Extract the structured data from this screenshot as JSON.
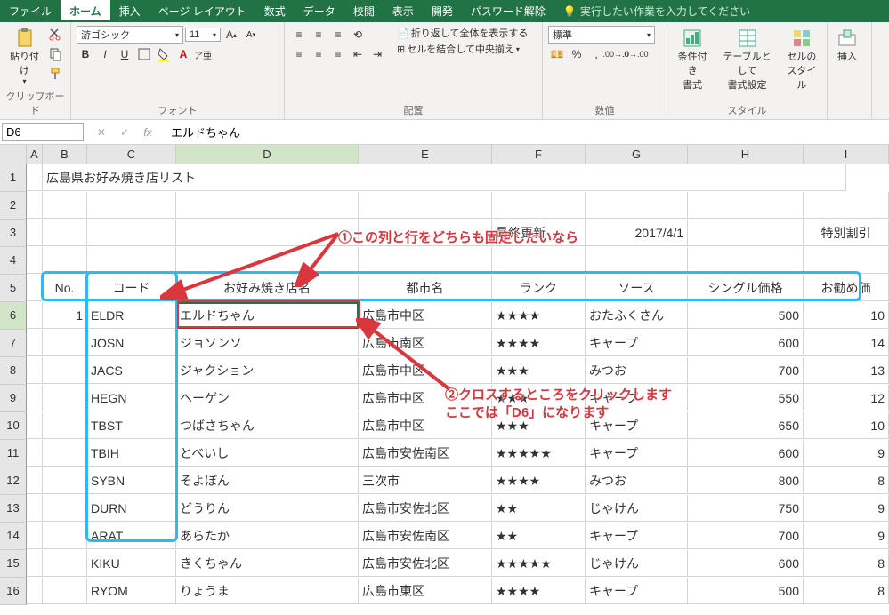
{
  "tabs": {
    "file": "ファイル",
    "home": "ホーム",
    "insert": "挿入",
    "layout": "ページ レイアウト",
    "formulas": "数式",
    "data": "データ",
    "review": "校閲",
    "view": "表示",
    "dev": "開発",
    "unlock": "パスワード解除",
    "tellme": "実行したい作業を入力してください"
  },
  "ribbon": {
    "clipboard": {
      "label": "クリップボード",
      "paste": "貼り付け"
    },
    "font": {
      "label": "フォント",
      "name": "游ゴシック",
      "size": "11",
      "bold": "B",
      "italic": "I",
      "underline": "U"
    },
    "align": {
      "label": "配置",
      "wrap": "折り返して全体を表示する",
      "merge": "セルを結合して中央揃え"
    },
    "number": {
      "label": "数値",
      "format": "標準"
    },
    "styles": {
      "label": "スタイル",
      "cond": "条件付き\n書式",
      "table": "テーブルとして\n書式設定",
      "cell": "セルの\nスタイル"
    },
    "cells": {
      "insert": "挿入"
    }
  },
  "namebox": "D6",
  "formula": "エルドちゃん",
  "cols": [
    "A",
    "B",
    "C",
    "D",
    "E",
    "F",
    "G",
    "H",
    "I"
  ],
  "sheet": {
    "title": "広島県お好み焼き店リスト",
    "update_label": "最終更新",
    "update_date": "2017/4/1",
    "special": "特別割引",
    "headers": {
      "no": "No.",
      "code": "コード",
      "name": "お好み焼き店名",
      "city": "都市名",
      "rank": "ランク",
      "sauce": "ソース",
      "single": "シングル価格",
      "rec": "お勧め価"
    },
    "rows": [
      {
        "no": "1",
        "code": "ELDR",
        "name": "エルドちゃん",
        "city": "広島市中区",
        "rank": "★★★★",
        "sauce": "おたふくさん",
        "single": "500",
        "rec": "10"
      },
      {
        "no": "",
        "code": "JOSN",
        "name": "ジョソンソ",
        "city": "広島市南区",
        "rank": "★★★★",
        "sauce": "キャープ",
        "single": "600",
        "rec": "14"
      },
      {
        "no": "",
        "code": "JACS",
        "name": "ジャクション",
        "city": "広島市中区",
        "rank": "★★★",
        "sauce": "みつお",
        "single": "700",
        "rec": "13"
      },
      {
        "no": "",
        "code": "HEGN",
        "name": "ヘーゲン",
        "city": "広島市中区",
        "rank": "★★★",
        "sauce": "キャープ",
        "single": "550",
        "rec": "12"
      },
      {
        "no": "",
        "code": "TBST",
        "name": "つばさちゃん",
        "city": "広島市中区",
        "rank": "★★★",
        "sauce": "キャープ",
        "single": "650",
        "rec": "10"
      },
      {
        "no": "",
        "code": "TBIH",
        "name": "とべいし",
        "city": "広島市安佐南区",
        "rank": "★★★★★",
        "sauce": "キャープ",
        "single": "600",
        "rec": "9"
      },
      {
        "no": "",
        "code": "SYBN",
        "name": "そよぼん",
        "city": "三次市",
        "rank": "★★★★",
        "sauce": "みつお",
        "single": "800",
        "rec": "8"
      },
      {
        "no": "",
        "code": "DURN",
        "name": "どうりん",
        "city": "広島市安佐北区",
        "rank": "★★",
        "sauce": "じゃけん",
        "single": "750",
        "rec": "9"
      },
      {
        "no": "",
        "code": "ARAT",
        "name": "あらたか",
        "city": "広島市安佐南区",
        "rank": "★★",
        "sauce": "キャープ",
        "single": "700",
        "rec": "9"
      },
      {
        "no": "",
        "code": "KIKU",
        "name": "きくちゃん",
        "city": "広島市安佐北区",
        "rank": "★★★★★",
        "sauce": "じゃけん",
        "single": "600",
        "rec": "8"
      },
      {
        "no": "",
        "code": "RYOM",
        "name": "りょうま",
        "city": "広島市東区",
        "rank": "★★★★",
        "sauce": "キャープ",
        "single": "500",
        "rec": "8"
      }
    ]
  },
  "anno": {
    "t1": "①この列と行をどちらも固定したいなら",
    "t2a": "②クロスするところをクリックします",
    "t2b": "ここでは「D6」になります"
  }
}
